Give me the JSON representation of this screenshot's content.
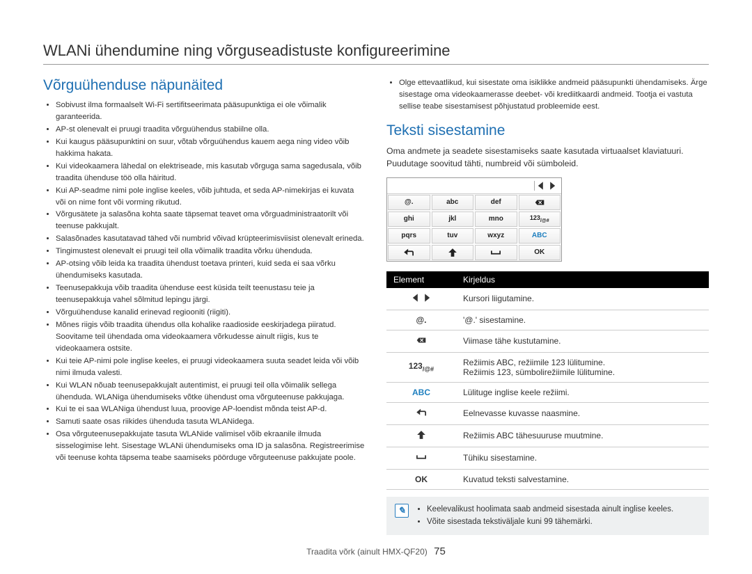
{
  "title": "WLANi ühendumine ning võrguseadistuste konfigureerimine",
  "left": {
    "heading": "Võrguühenduse näpunäited",
    "bullets": [
      "Sobivust ilma formaalselt Wi-Fi sertifitseerimata pääsupunktiga ei ole võimalik garanteerida.",
      "AP-st olenevalt ei pruugi traadita võrguühendus stabiilne olla.",
      "Kui kaugus pääsupunktini on suur, võtab võrguühendus kauem aega ning video võib hakkima hakata.",
      "Kui videokaamera lähedal on elektriseade, mis kasutab võrguga sama sagedusala, võib traadita ühenduse töö olla häiritud.",
      "Kui AP-seadme nimi pole inglise keeles, võib juhtuda, et seda AP-nimekirjas ei kuvata või on nime font või vorming rikutud.",
      "Võrgusätete ja salasõna kohta saate täpsemat teavet oma võrguadministraatorilt või teenuse pakkujalt.",
      "Salasõnades kasutatavad tähed või numbrid võivad krüpteerimisviisist olenevalt erineda.",
      "Tingimustest olenevalt ei pruugi teil olla võimalik traadita võrku ühenduda.",
      "AP-otsing võib leida ka traadita ühendust toetava printeri, kuid seda ei saa võrku ühendumiseks kasutada.",
      "Teenusepakkuja võib traadita ühenduse eest küsida teilt teenustasu teie ja teenusepakkuja vahel sõlmitud lepingu järgi.",
      "Võrguühenduse kanalid erinevad regiooniti (riigiti).",
      "Mõnes riigis võib traadita ühendus olla kohalike raadioside eeskirjadega piiratud. Soovitame teil ühendada oma videokaamera võrkudesse ainult riigis, kus te videokaamera ostsite.",
      "Kui teie AP-nimi pole inglise keeles, ei pruugi videokaamera suuta seadet leida või võib nimi ilmuda valesti.",
      "Kui WLAN nõuab teenusepakkujalt autentimist, ei pruugi teil olla võimalik sellega ühenduda. WLANiga ühendumiseks võtke ühendust oma võrguteenuse pakkujaga.",
      "Kui te ei saa WLANiga ühendust luua, proovige AP-loendist mõnda teist AP-d.",
      "Samuti saate osas riikides ühenduda tasuta WLANidega.",
      "Osa võrguteenusepakkujate tasuta WLANide valimisel võib ekraanile ilmuda sisselogimise leht. Sisestage WLANi ühendumiseks oma ID ja salasõna. Registreerimise või teenuse kohta täpsema teabe saamiseks pöörduge võrguteenuse pakkujate poole."
    ]
  },
  "right": {
    "bullets_top": [
      "Olge ettevaatlikud, kui sisestate oma isiklikke andmeid pääsupunkti ühendamiseks. Ärge sisestage oma videokaamerasse deebet- või krediitkaardi andmeid. Tootja ei vastuta sellise teabe sisestamisest põhjustatud probleemide eest."
    ],
    "heading": "Teksti sisestamine",
    "intro": "Oma andmete ja seadete sisestamiseks saate kasutada virtuaalset klaviatuuri. Puudutage soovitud tähti, numbreid või sümboleid.",
    "vk": {
      "rows": [
        [
          "@.",
          "abc",
          "def",
          "BKSP"
        ],
        [
          "ghi",
          "jkl",
          "mno",
          "123/@#"
        ],
        [
          "pqrs",
          "tuv",
          "wxyz",
          "ABC"
        ],
        [
          "BACK",
          "SHIFT",
          "SPACE",
          "OK"
        ]
      ]
    },
    "table": {
      "head": {
        "element": "Element",
        "desc": "Kirjeldus"
      },
      "rows": [
        {
          "icon": "ARROWS",
          "desc": "Kursori liigutamine."
        },
        {
          "icon": "@.",
          "desc": "'@.' sisestamine."
        },
        {
          "icon": "BKSP",
          "desc": "Viimase tähe kustutamine."
        },
        {
          "icon": "123/@#",
          "desc_a": "Režiimis ABC, režiimile 123 lülitumine.",
          "desc_b": "Režiimis 123, sümbolirežiimile lülitumine."
        },
        {
          "icon": "ABC",
          "desc": "Lülituge inglise keele režiimi."
        },
        {
          "icon": "BACK",
          "desc": "Eelnevasse kuvasse naasmine."
        },
        {
          "icon": "SHIFT",
          "desc": "Režiimis ABC tähesuuruse muutmine."
        },
        {
          "icon": "SPACE",
          "desc": "Tühiku sisestamine."
        },
        {
          "icon": "OK",
          "desc": "Kuvatud teksti salvestamine."
        }
      ]
    },
    "notes": [
      "Keelevalikust hoolimata saab andmeid sisestada ainult inglise keeles.",
      "Võite sisestada tekstiväljale kuni 99 tähemärki."
    ]
  },
  "footer": {
    "text": "Traadita võrk (ainult HMX-QF20)",
    "page": "75"
  }
}
